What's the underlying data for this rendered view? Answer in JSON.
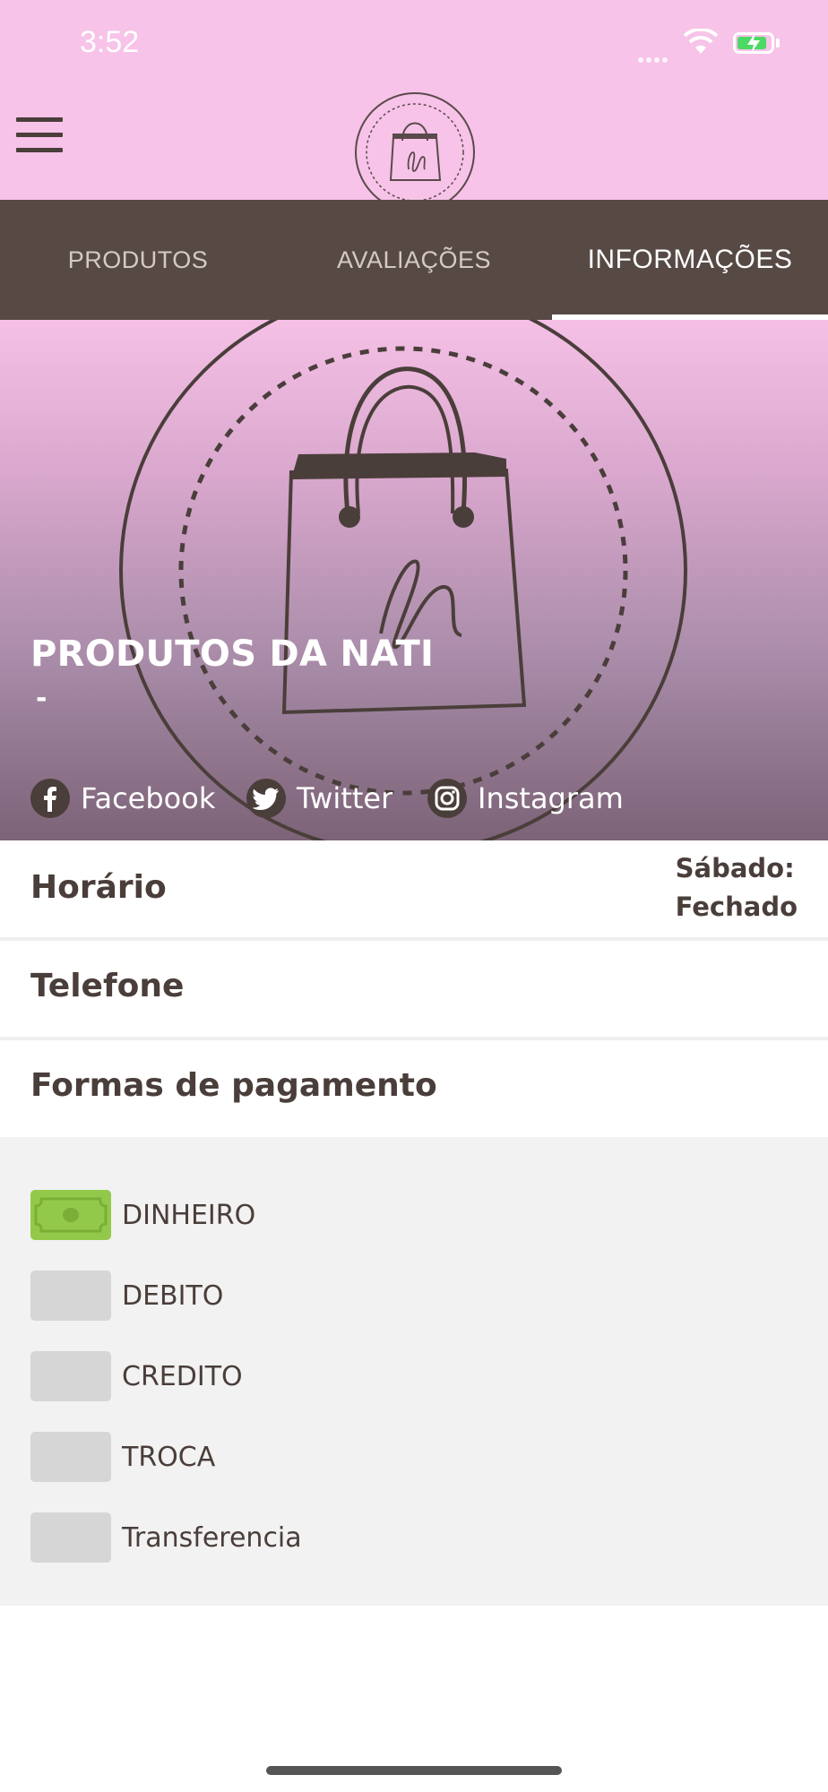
{
  "status_bar": {
    "time": "3:52"
  },
  "header": {
    "menu_icon": "hamburger-menu-icon",
    "logo_icon": "shopping-bag-n-logo"
  },
  "tabs": [
    {
      "label": "PRODUTOS",
      "active": false
    },
    {
      "label": "AVALIAÇÕES",
      "active": false
    },
    {
      "label": "INFORMAÇÕES",
      "active": true
    }
  ],
  "store": {
    "name": "PRODUTOS DA NATI",
    "subtitle": "-",
    "social": [
      {
        "label": "Facebook",
        "icon": "facebook-icon"
      },
      {
        "label": "Twitter",
        "icon": "twitter-icon"
      },
      {
        "label": "Instagram",
        "icon": "instagram-icon"
      }
    ]
  },
  "info": {
    "hours_label": "Horário",
    "hours_day": "Sábado:",
    "hours_status": "Fechado",
    "phone_label": "Telefone",
    "payment_label": "Formas de pagamento"
  },
  "payment_methods": [
    {
      "label": "DINHEIRO",
      "icon": "cash-icon",
      "color": "#93c94a"
    },
    {
      "label": "DEBITO",
      "icon": "debit-card-icon",
      "color": "#d6d6d6"
    },
    {
      "label": "CREDITO",
      "icon": "credit-card-icon",
      "color": "#d6d6d6"
    },
    {
      "label": "TROCA",
      "icon": "exchange-icon",
      "color": "#d6d6d6"
    },
    {
      "label": "Transferencia",
      "icon": "transfer-icon",
      "color": "#d6d6d6"
    }
  ],
  "colors": {
    "header_pink": "#f7c3e8",
    "tab_bar": "#574a45",
    "text_dark": "#4a3e3a",
    "cash_green": "#93c94a"
  }
}
